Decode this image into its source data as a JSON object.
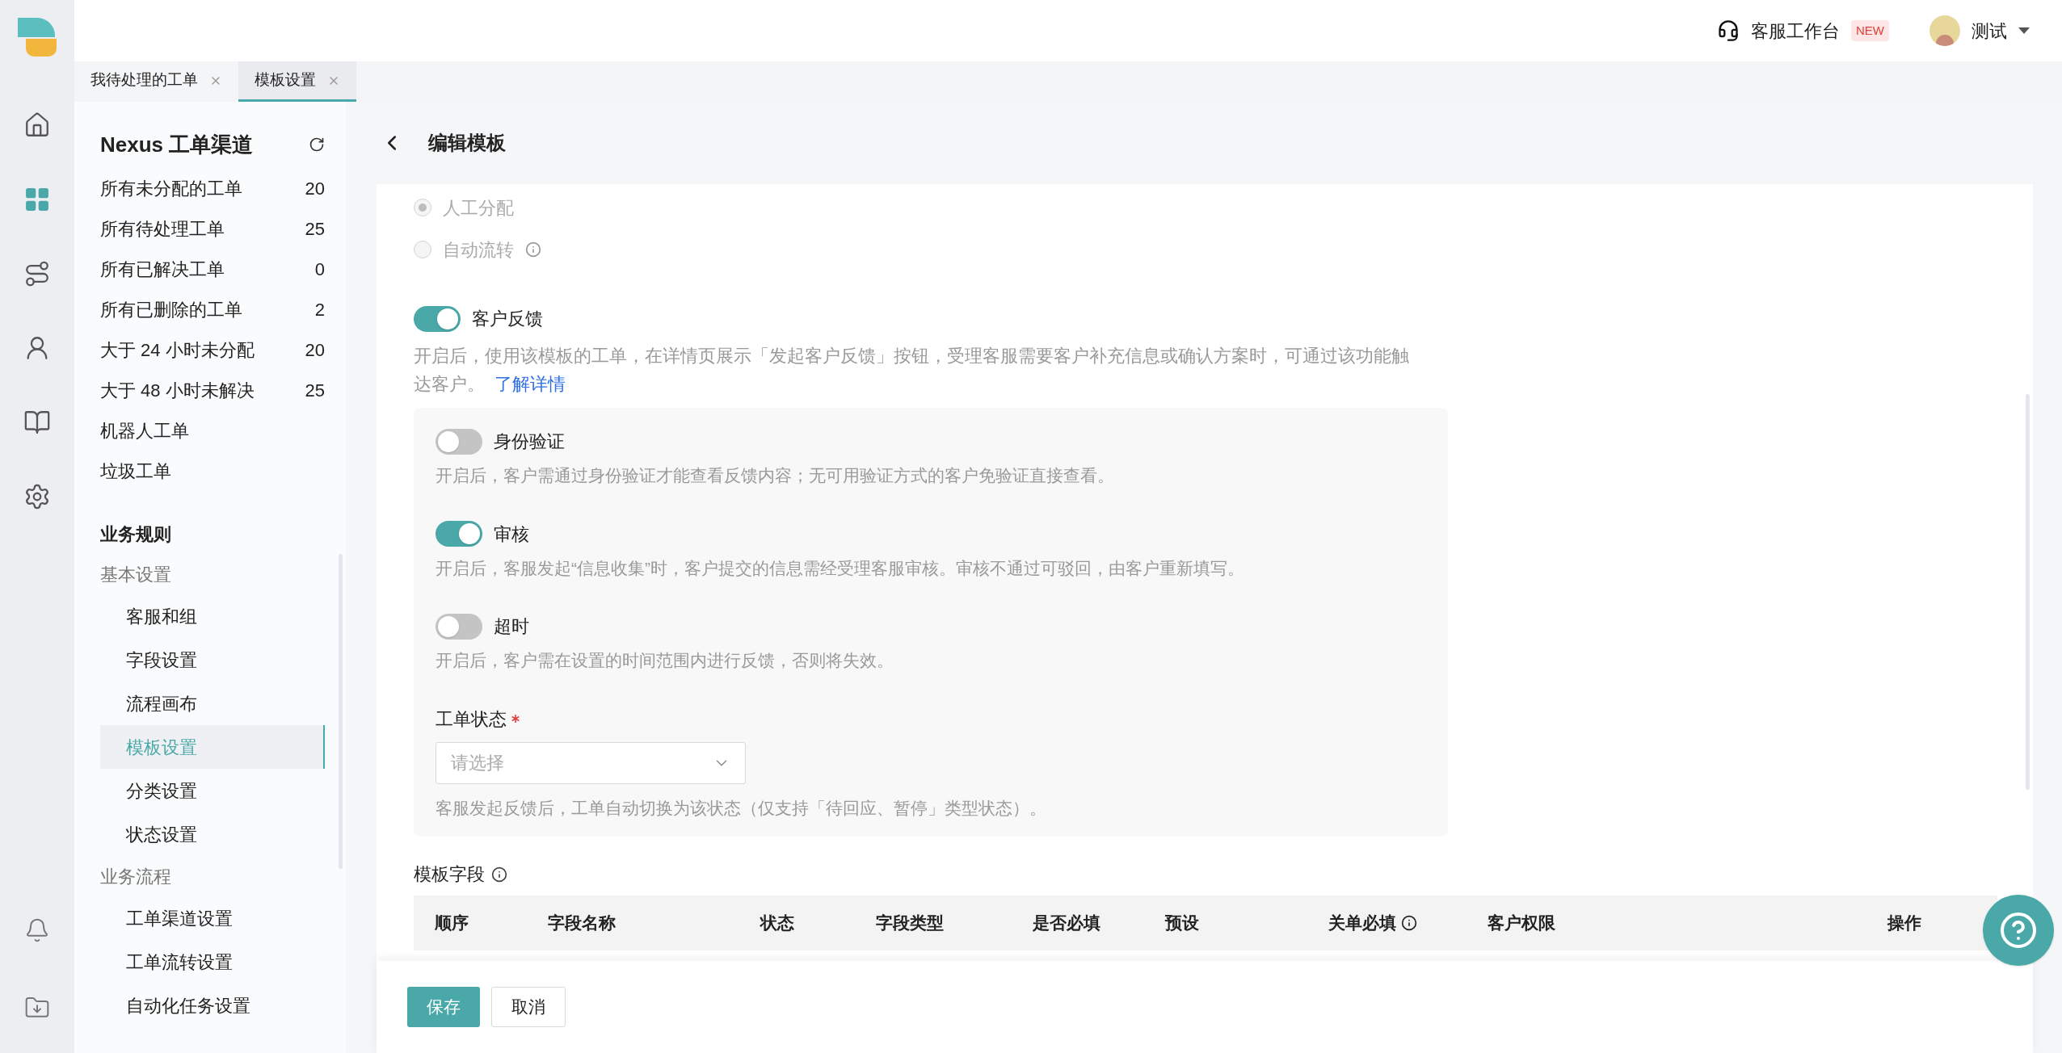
{
  "rail": {
    "items": [
      {
        "selected": false
      },
      {
        "selected": true
      },
      {
        "selected": false
      },
      {
        "selected": false
      },
      {
        "selected": false
      },
      {
        "selected": false
      }
    ],
    "bottom_items": [
      {
        "selected": false
      },
      {
        "selected": false
      }
    ]
  },
  "top_bar": {
    "workbench": "客服工作台",
    "badge": "NEW",
    "user": "测试"
  },
  "tabs": [
    {
      "label": "我待处理的工单",
      "selected": false
    },
    {
      "label": "模板设置",
      "selected": true
    }
  ],
  "sidebar": {
    "title": "Nexus 工单渠道",
    "views": [
      {
        "label": "所有未分配的工单",
        "count": "20"
      },
      {
        "label": "所有待处理工单",
        "count": "25"
      },
      {
        "label": "所有已解决工单",
        "count": "0"
      },
      {
        "label": "所有已删除的工单",
        "count": "2"
      },
      {
        "label": "大于 24 小时未分配",
        "count": "20"
      },
      {
        "label": "大于 48 小时未解决",
        "count": "25"
      },
      {
        "label": "机器人工单"
      },
      {
        "label": "垃圾工单"
      }
    ],
    "section": {
      "title": "业务规则",
      "groups": [
        {
          "title": "基本设置",
          "items": [
            {
              "label": "客服和组",
              "selected": false
            },
            {
              "label": "字段设置",
              "selected": false
            },
            {
              "label": "流程画布",
              "selected": false
            },
            {
              "label": "模板设置",
              "selected": true
            },
            {
              "label": "分类设置",
              "selected": false
            },
            {
              "label": "状态设置",
              "selected": false
            }
          ]
        },
        {
          "title": "业务流程",
          "items": [
            {
              "label": "工单渠道设置",
              "selected": false
            },
            {
              "label": "工单流转设置",
              "selected": false
            },
            {
              "label": "自动化任务设置",
              "selected": false
            }
          ]
        }
      ]
    }
  },
  "page": {
    "title": "编辑模板",
    "assignment": {
      "disabled": true,
      "options": [
        {
          "label": "人工分配",
          "selected": true,
          "info": false
        },
        {
          "label": "自动流转",
          "selected": false,
          "info": true
        }
      ]
    },
    "feedback": {
      "label": "客户反馈",
      "on": true,
      "description": "开启后，使用该模板的工单，在详情页展示「发起客户反馈」按钮，受理客服需要客户补充信息或确认方案时，可通过该功能触达客户。",
      "link": "了解详情",
      "options": [
        {
          "label": "身份验证",
          "on": false,
          "description": "开启后，客户需通过身份验证才能查看反馈内容；无可用验证方式的客户免验证直接查看。"
        },
        {
          "label": "审核",
          "on": true,
          "description": "开启后，客服发起“信息收集”时，客户提交的信息需经受理客服审核。审核不通过可驳回，由客户重新填写。"
        },
        {
          "label": "超时",
          "on": false,
          "description": "开启后，客户需在设置的时间范围内进行反馈，否则将失效。"
        }
      ],
      "status_field": {
        "label": "工单状态",
        "required": true,
        "placeholder": "请选择",
        "help": "客服发起反馈后，工单自动切换为该状态（仅支持「待回应、暂停」类型状态）。"
      }
    },
    "template_fields": {
      "title": "模板字段",
      "columns": [
        {
          "label": "顺序",
          "info": false
        },
        {
          "label": "字段名称",
          "info": false
        },
        {
          "label": "状态",
          "info": false
        },
        {
          "label": "字段类型",
          "info": false
        },
        {
          "label": "是否必填",
          "info": false
        },
        {
          "label": "预设",
          "info": false
        },
        {
          "label": "关单必填",
          "info": true
        },
        {
          "label": "客户权限",
          "info": false
        },
        {
          "label": "操作",
          "info": false
        }
      ]
    }
  },
  "footer": {
    "buttons": [
      {
        "label": "保存",
        "kind": "primary"
      },
      {
        "label": "取消",
        "kind": "default"
      }
    ]
  }
}
